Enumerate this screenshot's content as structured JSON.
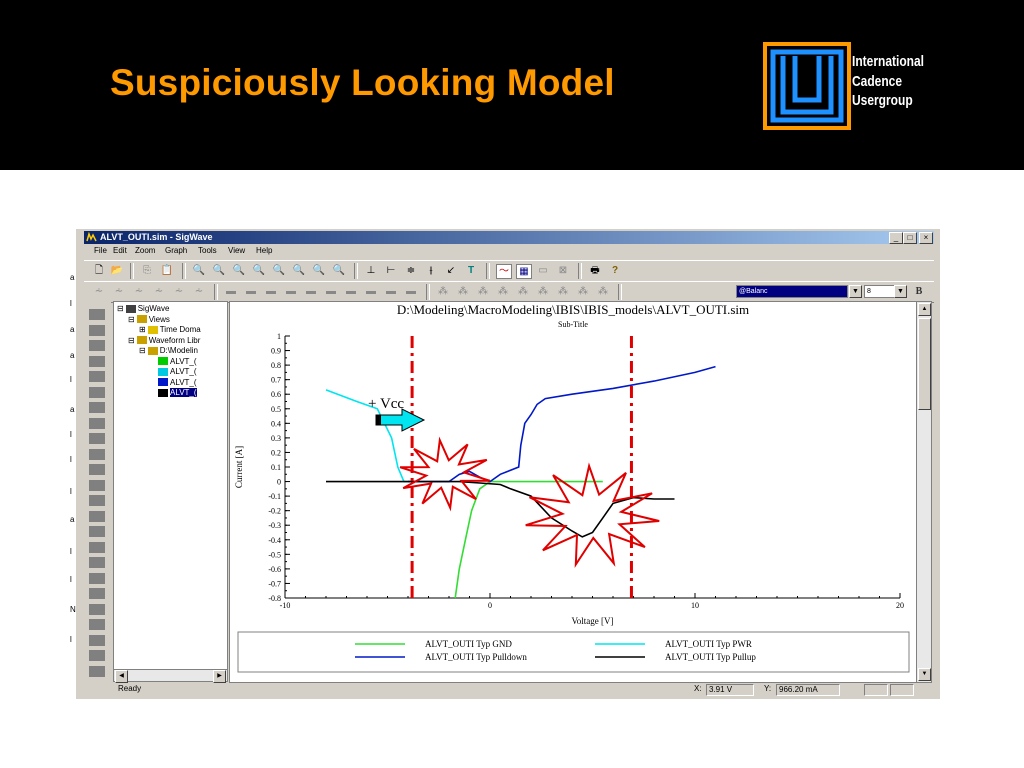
{
  "slide": {
    "title": "Suspiciously Looking Model",
    "logo_lines": [
      "International",
      "Cadence",
      "Usergroup"
    ]
  },
  "edge_labels": [
    "a",
    "l",
    "a",
    "a",
    "l",
    "a",
    "l",
    "l",
    "l",
    "a",
    "l",
    "l",
    "N",
    "l"
  ],
  "window": {
    "title": "ALVT_OUTI.sim - SigWave",
    "buttons": [
      "_",
      "□",
      "×"
    ]
  },
  "menu": [
    "File",
    "Edit",
    "Zoom",
    "Graph",
    "Tools",
    "View",
    "Help"
  ],
  "toolbar": {
    "select_value": "@Balanc",
    "select2_value": "8",
    "bold_label": "B"
  },
  "tree": {
    "items": [
      {
        "label": "SigWave",
        "indent": 0,
        "expander": "⊟",
        "icon": "computer-icon"
      },
      {
        "label": "Views",
        "indent": 1,
        "expander": "⊟",
        "icon": "folder-icon"
      },
      {
        "label": "Time Doma",
        "indent": 2,
        "expander": "⊞",
        "icon": "clock-icon"
      },
      {
        "label": "Waveform Libr",
        "indent": 1,
        "expander": "⊟",
        "icon": "folder-icon"
      },
      {
        "label": "D:\\Modelin",
        "indent": 2,
        "expander": "⊟",
        "icon": "folder-icon"
      },
      {
        "label": "ALVT_(",
        "indent": 3,
        "expander": "",
        "icon": "waveform-green-icon"
      },
      {
        "label": "ALVT_(",
        "indent": 3,
        "expander": "",
        "icon": "waveform-cyan-icon"
      },
      {
        "label": "ALVT_(",
        "indent": 3,
        "expander": "",
        "icon": "waveform-blue-icon"
      },
      {
        "label": "ALVT_(",
        "indent": 3,
        "expander": "",
        "icon": "waveform-black-icon",
        "selected": true
      }
    ]
  },
  "status": {
    "ready": "Ready",
    "x_label": "X:",
    "x_value": "3.91 V",
    "y_label": "Y:",
    "y_value": "966.20 mA"
  },
  "annotation": {
    "vcc_label": "+ Vcc",
    "marker_color": "#e00000"
  },
  "colors": {
    "gnd": "#33dd33",
    "pwr": "#00e5f0",
    "pulldown": "#0018c8",
    "pullup": "#000000",
    "accent": "#ff9900"
  },
  "chart_data": {
    "type": "line",
    "title": "D:\\Modeling\\MacroModeling\\IBIS\\IBIS_models\\ALVT_OUTI.sim",
    "subtitle": "Sub-Title",
    "xlabel": "Voltage [V]",
    "ylabel": "Current [A]",
    "xlim": [
      -10,
      20
    ],
    "ylim": [
      -0.8,
      1
    ],
    "xticks": [
      -10,
      0,
      10,
      20
    ],
    "yticks": [
      1,
      0.9,
      0.8,
      0.7,
      0.6,
      0.5,
      0.4,
      0.3,
      0.2,
      0.1,
      0,
      -0.1,
      -0.2,
      -0.3,
      -0.4,
      -0.5,
      -0.6,
      -0.7,
      -0.8
    ],
    "markers_x": [
      -3.8,
      6.9
    ],
    "series": [
      {
        "name": "ALVT_OUTI Typ  GND",
        "color": "#33dd33",
        "points": [
          [
            -1.7,
            -0.8
          ],
          [
            -1.5,
            -0.6
          ],
          [
            -1.2,
            -0.4
          ],
          [
            -0.9,
            -0.2
          ],
          [
            -0.5,
            -0.05
          ],
          [
            0,
            0
          ],
          [
            2,
            0
          ],
          [
            5.5,
            0
          ]
        ]
      },
      {
        "name": "ALVT_OUTI Typ  PWR",
        "color": "#00e5f0",
        "points": [
          [
            -8,
            0.63
          ],
          [
            -6.5,
            0.55
          ],
          [
            -5.5,
            0.5
          ],
          [
            -4.8,
            0.3
          ],
          [
            -4.5,
            0.1
          ],
          [
            -4.2,
            0
          ],
          [
            -3.5,
            0
          ]
        ]
      },
      {
        "name": "ALVT_OUTI Typ  Pulldown",
        "color": "#0018c8",
        "points": [
          [
            -4,
            0
          ],
          [
            -3,
            0
          ],
          [
            -2,
            0
          ],
          [
            -1.5,
            0.05
          ],
          [
            -1,
            0.07
          ],
          [
            -0.5,
            0.03
          ],
          [
            0,
            0
          ],
          [
            0.5,
            0.05
          ],
          [
            1.4,
            0.1
          ],
          [
            1.5,
            0.25
          ],
          [
            1.7,
            0.4
          ],
          [
            2,
            0.46
          ],
          [
            2.3,
            0.53
          ],
          [
            2.7,
            0.57
          ],
          [
            4,
            0.6
          ],
          [
            6,
            0.64
          ],
          [
            8,
            0.69
          ],
          [
            10,
            0.75
          ],
          [
            11,
            0.79
          ]
        ]
      },
      {
        "name": "ALVT_OUTI Typ  Pullup",
        "color": "#000000",
        "points": [
          [
            -8,
            0
          ],
          [
            -5,
            0
          ],
          [
            -1.5,
            0
          ],
          [
            -0.5,
            -0.01
          ],
          [
            0.5,
            -0.02
          ],
          [
            1,
            -0.05
          ],
          [
            2,
            -0.1
          ],
          [
            3,
            -0.25
          ],
          [
            4,
            -0.34
          ],
          [
            4.5,
            -0.38
          ],
          [
            5,
            -0.35
          ],
          [
            5.5,
            -0.25
          ],
          [
            6,
            -0.15
          ],
          [
            7,
            -0.11
          ],
          [
            8,
            -0.12
          ],
          [
            9,
            -0.12
          ]
        ]
      }
    ],
    "legend_position": "bottom",
    "grid": false
  }
}
